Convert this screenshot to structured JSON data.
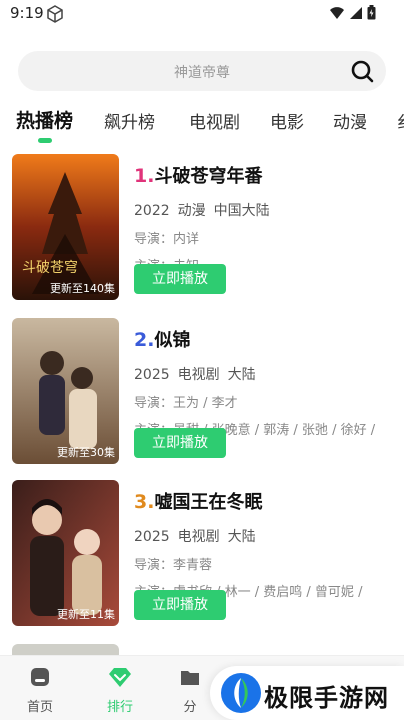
{
  "status_bar": {
    "time": "9:19"
  },
  "search": {
    "placeholder": "神道帝尊"
  },
  "tabs": [
    {
      "label": "热播榜",
      "active": true
    },
    {
      "label": "飙升榜"
    },
    {
      "label": "电视剧"
    },
    {
      "label": "电影"
    },
    {
      "label": "动漫"
    },
    {
      "label": "纟"
    }
  ],
  "items": [
    {
      "rank": "1.",
      "rank_color": "#e0337a",
      "title": "斗破苍穹年番",
      "year": "2022",
      "genre": "动漫",
      "region": "中国大陆",
      "director": "导演：内详",
      "cast": "主演：未知",
      "badge": "更新至140集",
      "play_label": "立即播放"
    },
    {
      "rank": "2.",
      "rank_color": "#3a5bd9",
      "title": "似锦",
      "year": "2025",
      "genre": "电视剧",
      "region": "大陆",
      "director": "导演：王为 / 李才",
      "cast": "主演：景甜 / 张晚意 / 郭涛 / 张弛 / 徐好 /",
      "badge": "更新至30集",
      "play_label": "立即播放"
    },
    {
      "rank": "3.",
      "rank_color": "#e08a1e",
      "title": "嘘国王在冬眠",
      "year": "2025",
      "genre": "电视剧",
      "region": "大陆",
      "director": "导演：李青蓉",
      "cast": "主演：虞书欣 / 林一 / 费启鸣 / 曾可妮 /",
      "badge": "更新至11集",
      "play_label": "立即播放"
    }
  ],
  "bottom_nav": [
    {
      "label": "首页",
      "icon": "home-icon"
    },
    {
      "label": "排行",
      "icon": "diamond-icon",
      "active": true
    },
    {
      "label": "分",
      "icon": "folder-icon"
    }
  ],
  "watermark": {
    "text": "极限手游网"
  },
  "colors": {
    "accent": "#2ecc71"
  }
}
